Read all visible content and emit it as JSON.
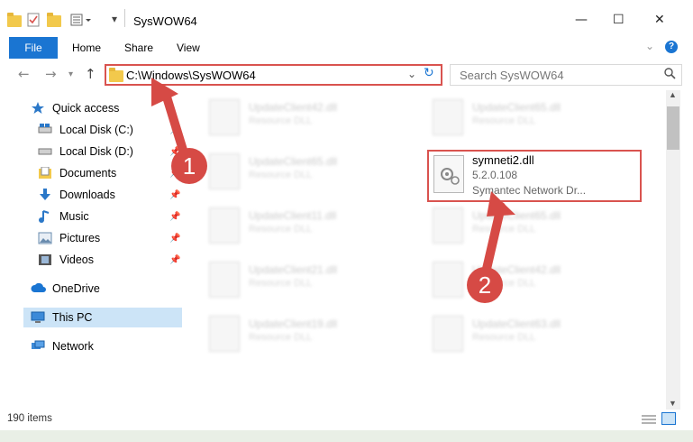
{
  "window": {
    "title": "SysWOW64",
    "controls": [
      "minimize",
      "maximize",
      "close"
    ]
  },
  "ribbon": {
    "file": "File",
    "tabs": [
      "Home",
      "Share",
      "View"
    ]
  },
  "address": {
    "path": "C:\\Windows\\SysWOW64",
    "search_placeholder": "Search SysWOW64"
  },
  "nav": {
    "items": [
      {
        "label": "Quick access",
        "icon": "star-icon",
        "pinned": false
      },
      {
        "label": "Local Disk (C:)",
        "icon": "drive-icon",
        "pinned": true
      },
      {
        "label": "Local Disk (D:)",
        "icon": "drive-icon",
        "pinned": true
      },
      {
        "label": "Documents",
        "icon": "documents-icon",
        "pinned": true
      },
      {
        "label": "Downloads",
        "icon": "download-icon",
        "pinned": true
      },
      {
        "label": "Music",
        "icon": "music-icon",
        "pinned": true
      },
      {
        "label": "Pictures",
        "icon": "pictures-icon",
        "pinned": true
      },
      {
        "label": "Videos",
        "icon": "videos-icon",
        "pinned": true
      },
      {
        "label": "OneDrive",
        "icon": "cloud-icon",
        "pinned": false
      },
      {
        "label": "This PC",
        "icon": "pc-icon",
        "pinned": false,
        "selected": true
      },
      {
        "label": "Network",
        "icon": "network-icon",
        "pinned": false
      }
    ]
  },
  "files": {
    "left_column": [
      {
        "name": "UpdateClient42.dll",
        "desc": "Resource DLL"
      },
      {
        "name": "UpdateClient65.dll",
        "desc": "Resource DLL"
      },
      {
        "name": "UpdateClient11.dll",
        "desc": "Resource DLL"
      },
      {
        "name": "UpdateClient21.dll",
        "desc": "Resource DLL"
      },
      {
        "name": "UpdateClient19.dll",
        "desc": "Resource DLL"
      }
    ],
    "right_column": [
      {
        "name": "UpdateClient65.dll",
        "desc": "Resource DLL"
      },
      {
        "name": "UpdateClient65.dll",
        "desc": "Resource DLL"
      },
      {
        "name": "UpdateClient42.dll",
        "desc": "Resource DLL"
      },
      {
        "name": "UpdateClient63.dll",
        "desc": "Resource DLL"
      }
    ],
    "highlighted": {
      "name": "symneti2.dll",
      "version": "5.2.0.108",
      "desc": "Symantec Network Dr..."
    }
  },
  "status": {
    "items_count": "190 items"
  },
  "annotations": {
    "badge1": "1",
    "badge2": "2",
    "color": "#d64a45"
  }
}
